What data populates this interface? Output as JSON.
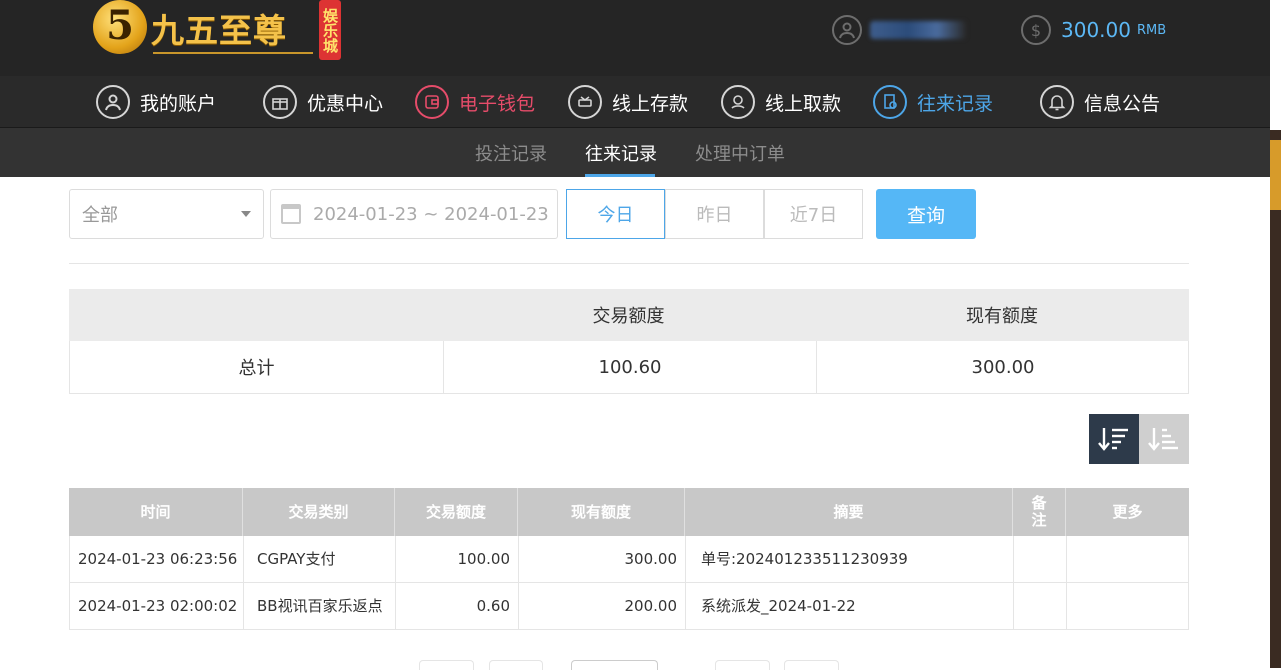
{
  "header": {
    "logo_mark": "5",
    "logo_text": "九五至尊",
    "logo_badge": "娱乐城",
    "balance_amount": "300.00",
    "balance_currency": "RMB"
  },
  "main_nav": [
    {
      "label": "我的账户",
      "icon": "user-icon"
    },
    {
      "label": "优惠中心",
      "icon": "gift-icon"
    },
    {
      "label": "电子钱包",
      "icon": "wallet-icon"
    },
    {
      "label": "线上存款",
      "icon": "deposit-icon"
    },
    {
      "label": "线上取款",
      "icon": "withdraw-icon"
    },
    {
      "label": "往来记录",
      "icon": "records-icon"
    },
    {
      "label": "信息公告",
      "icon": "bell-icon"
    }
  ],
  "sub_nav": [
    {
      "label": "投注记录"
    },
    {
      "label": "往来记录"
    },
    {
      "label": "处理中订单"
    }
  ],
  "filters": {
    "type_selected": "全部",
    "date_range": "2024-01-23 ~ 2024-01-23",
    "quick_dates": [
      "今日",
      "昨日",
      "近7日"
    ],
    "query_label": "查询"
  },
  "summary": {
    "col_amount": "交易额度",
    "col_balance": "现有额度",
    "row_label": "总计",
    "amount": "100.60",
    "balance": "300.00"
  },
  "records": {
    "headers": [
      "时间",
      "交易类别",
      "交易额度",
      "现有额度",
      "摘要",
      "备注",
      "更多"
    ],
    "rows": [
      {
        "time": "2024-01-23 06:23:56",
        "category": "CGPAY支付",
        "amount": "100.00",
        "balance": "300.00",
        "summary": "单号:202401233511230939",
        "note": "",
        "more": ""
      },
      {
        "time": "2024-01-23 02:00:02",
        "category": "BB视讯百家乐返点",
        "amount": "0.60",
        "balance": "200.00",
        "summary": "系统派发_2024-01-22",
        "note": "",
        "more": ""
      }
    ]
  },
  "colors": {
    "accent_blue": "#4da6e8",
    "wallet_red": "#e64c6a",
    "header_bg": "#252525"
  }
}
